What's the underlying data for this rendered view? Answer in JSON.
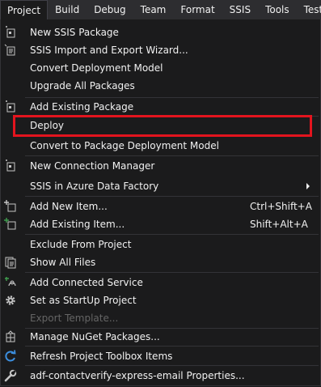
{
  "menubar": {
    "items": [
      "Project",
      "Build",
      "Debug",
      "Team",
      "Format",
      "SSIS",
      "Tools",
      "Test"
    ]
  },
  "menu": {
    "items": [
      {
        "label": "New SSIS Package",
        "icon": "ssis-package-icon"
      },
      {
        "label": "SSIS Import and Export Wizard...",
        "icon": "ssis-wizard-icon"
      },
      {
        "label": "Convert Deployment Model"
      },
      {
        "label": "Upgrade All Packages"
      },
      {
        "label": "Add Existing Package",
        "icon": "ssis-package-icon"
      },
      {
        "label": "Deploy"
      },
      {
        "label": "Convert to Package Deployment Model"
      },
      {
        "label": "New Connection Manager",
        "icon": "connection-manager-icon"
      },
      {
        "label": "SSIS in Azure Data Factory",
        "submenu": true
      },
      {
        "label": "Add New Item...",
        "shortcut": "Ctrl+Shift+A",
        "icon": "add-new-item-icon"
      },
      {
        "label": "Add Existing Item...",
        "shortcut": "Shift+Alt+A",
        "icon": "add-existing-item-icon"
      },
      {
        "label": "Exclude From Project"
      },
      {
        "label": "Show All Files",
        "icon": "show-all-files-icon"
      },
      {
        "label": "Add Connected Service",
        "icon": "connected-service-icon"
      },
      {
        "label": "Set as StartUp Project",
        "icon": "gear-icon"
      },
      {
        "label": "Export Template...",
        "disabled": true
      },
      {
        "label": "Manage NuGet Packages...",
        "icon": "nuget-icon"
      },
      {
        "label": "Refresh Project Toolbox Items",
        "icon": "refresh-icon"
      },
      {
        "label": "adf-contactverify-express-email Properties...",
        "icon": "wrench-icon"
      }
    ],
    "highlighted_item": "Deploy"
  },
  "colors": {
    "background": "#1b1b1c",
    "menubar": "#2d2d30",
    "text": "#f1f1f1",
    "disabled_text": "#656565",
    "highlight_border": "#e3141e"
  }
}
